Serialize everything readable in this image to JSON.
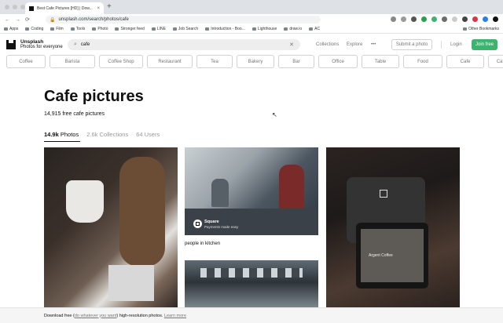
{
  "browser": {
    "tab_title": "Best Cafe Pictures [HD] | Dow...",
    "tab_close": "×",
    "new_tab": "+",
    "url": "unsplash.com/search/photos/cafe",
    "nav_back": "←",
    "nav_forward": "→",
    "nav_reload": "⟳",
    "bookmarks": [
      "Apps",
      "Coding",
      "Film",
      "Tools",
      "Photo",
      "Stronger feed",
      "LINE",
      "Job Search",
      "Introduction - Boo...",
      "Lighthouse",
      "draw.io",
      "AC"
    ],
    "other_bookmarks": "Other Bookmarks"
  },
  "header": {
    "brand_title": "Unsplash",
    "brand_sub": "Photos for everyone",
    "search_value": "cafe",
    "search_icon": "search-icon",
    "clear": "✕",
    "collections": "Collections",
    "explore": "Explore",
    "more": "•••",
    "submit": "Submit a photo",
    "login": "Login",
    "join": "Join free"
  },
  "chips": [
    "Coffee",
    "Barista",
    "Coffee Shop",
    "Restaurant",
    "Tea",
    "Bakery",
    "Bar",
    "Office",
    "Table",
    "Food",
    "Cafe",
    "Cafeteria"
  ],
  "page": {
    "title": "Cafe pictures",
    "subtitle": "14,915 free cafe pictures",
    "photos_count": "14.9k",
    "photos_label": "Photos",
    "collections_count": "2.6k",
    "collections_label": "Collections",
    "users_count": "64",
    "users_label": "Users"
  },
  "cards": {
    "square_name": "Square",
    "square_tagline": "Payments made easy",
    "caption": "people in kitchen",
    "tablet_text": "Argent Coffee"
  },
  "footer": {
    "pre": "Download free (",
    "link1": "do whatever you want",
    "mid": ") high-resolution photos. ",
    "link2": "Learn more"
  },
  "colors": {
    "accent": "#3cb46e",
    "text_muted": "#767676"
  }
}
